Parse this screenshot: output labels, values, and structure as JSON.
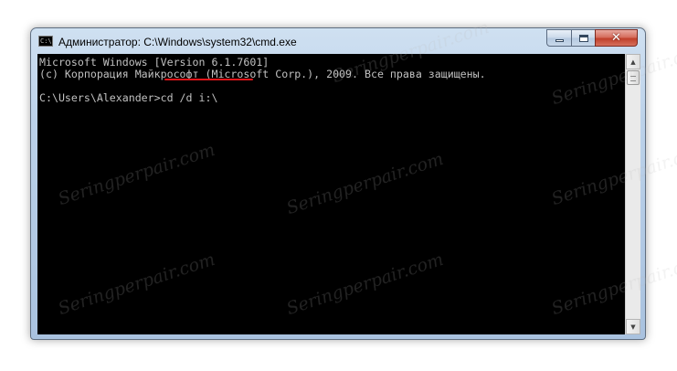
{
  "window": {
    "title": "Администратор: C:\\Windows\\system32\\cmd.exe",
    "icon_label": "C:\\",
    "minimize_icon": "minimize-icon",
    "maximize_icon": "maximize-icon",
    "close_glyph": "✕"
  },
  "console": {
    "lines": [
      "Microsoft Windows [Version 6.1.7601]",
      "(c) Корпорация Майкрософт (Microsoft Corp.), 2009. Все права защищены.",
      "",
      "C:\\Users\\Alexander>cd /d i:\\"
    ],
    "text_color": "#c0c0c0",
    "background": "#000000",
    "highlight_color": "#e0151a"
  },
  "scrollbar": {
    "up_arrow": "▲",
    "down_arrow": "▼"
  },
  "watermark": "Seringperpair.com"
}
